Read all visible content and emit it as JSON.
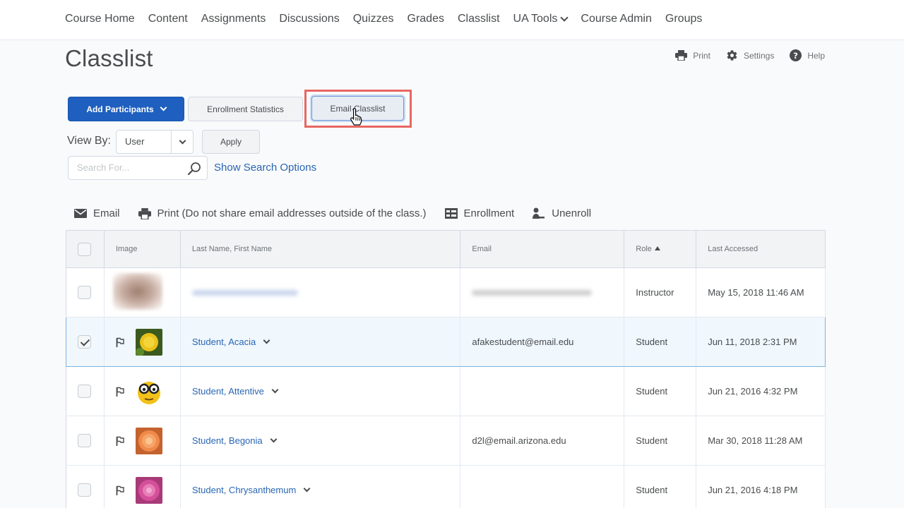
{
  "nav": {
    "items": [
      {
        "label": "Course Home"
      },
      {
        "label": "Content"
      },
      {
        "label": "Assignments"
      },
      {
        "label": "Discussions"
      },
      {
        "label": "Quizzes"
      },
      {
        "label": "Grades"
      },
      {
        "label": "Classlist"
      },
      {
        "label": "UA Tools",
        "dropdown": true
      },
      {
        "label": "Course Admin"
      },
      {
        "label": "Groups"
      }
    ]
  },
  "page": {
    "title": "Classlist"
  },
  "top_actions": {
    "print": "Print",
    "settings": "Settings",
    "help": "Help"
  },
  "buttons": {
    "add_participants": "Add Participants",
    "enrollment_statistics": "Enrollment Statistics",
    "email_classlist": "Email Classlist",
    "apply": "Apply"
  },
  "view_by": {
    "label": "View By:",
    "selected": "User"
  },
  "search": {
    "placeholder": "Search For...",
    "show_options": "Show Search Options"
  },
  "toolbar": {
    "email": "Email",
    "print": "Print (Do not share email addresses outside of the class.)",
    "enrollment": "Enrollment",
    "unenroll": "Unenroll"
  },
  "table": {
    "headers": {
      "image": "Image",
      "name": "Last Name, First Name",
      "email": "Email",
      "role": "Role",
      "last_accessed": "Last Accessed"
    },
    "rows": [
      {
        "name": "",
        "email": "",
        "role": "Instructor",
        "last_accessed": "May 15, 2018 11:46 AM",
        "checked": false,
        "blurred": true
      },
      {
        "name": "Student, Acacia",
        "email": "afakestudent@email.edu",
        "role": "Student",
        "last_accessed": "Jun 11, 2018 2:31 PM",
        "checked": true
      },
      {
        "name": "Student, Attentive",
        "email": "",
        "role": "Student",
        "last_accessed": "Jun 21, 2016 4:32 PM",
        "checked": false
      },
      {
        "name": "Student, Begonia",
        "email": "d2l@email.arizona.edu",
        "role": "Student",
        "last_accessed": "Mar 30, 2018 11:28 AM",
        "checked": false
      },
      {
        "name": "Student, Chrysanthemum",
        "email": "",
        "role": "Student",
        "last_accessed": "Jun 21, 2016 4:18 PM",
        "checked": false
      }
    ]
  },
  "colors": {
    "primary": "#1e5fbf",
    "link": "#2966b3",
    "highlight": "#e86763"
  }
}
